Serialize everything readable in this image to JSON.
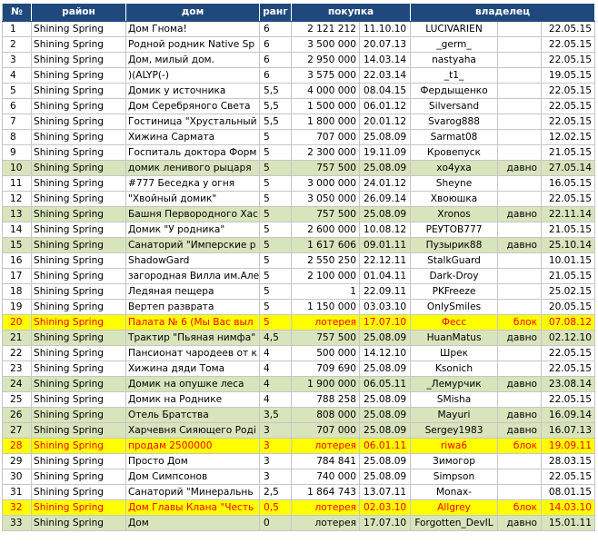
{
  "headers": {
    "num": "№",
    "district": "район",
    "house": "дом",
    "rank": "ранг",
    "purchase": "покупка",
    "owner": "владелец"
  },
  "colors": {
    "header_bg": "#1f497d",
    "header_text": "#ffffff",
    "green_row": "#d8e4bc",
    "yellow_row": "#ffff00",
    "yellow_row_text": "#ff0000"
  },
  "rows": [
    {
      "num": "1",
      "district": "Shining Spring",
      "house": "Дом Гнома!",
      "rank": "6",
      "price": "2 121 212",
      "date": "11.10.10",
      "owner": "LUCIVARIEN",
      "status": "",
      "owner_date": "22.05.15",
      "style": "plain"
    },
    {
      "num": "2",
      "district": "Shining Spring",
      "house": "Родной родник Native Sp",
      "rank": "6",
      "price": "3 500 000",
      "date": "20.07.13",
      "owner": "_germ_",
      "status": "",
      "owner_date": "22.05.15",
      "style": "plain"
    },
    {
      "num": "3",
      "district": "Shining Spring",
      "house": "Дом, милый дом.",
      "rank": "6",
      "price": "2 950 000",
      "date": "14.03.14",
      "owner": "nastyaha",
      "status": "",
      "owner_date": "22.05.15",
      "style": "plain"
    },
    {
      "num": "4",
      "district": "Shining Spring",
      "house": ")(ALYP(-)",
      "rank": "6",
      "price": "3 575 000",
      "date": "22.03.14",
      "owner": "_t1_",
      "status": "",
      "owner_date": "19.05.15",
      "style": "plain"
    },
    {
      "num": "5",
      "district": "Shining Spring",
      "house": "Домик у источника",
      "rank": "5,5",
      "price": "4 000 000",
      "date": "08.04.15",
      "owner": "Фердыщенко",
      "status": "",
      "owner_date": "22.05.15",
      "style": "plain"
    },
    {
      "num": "6",
      "district": "Shining Spring",
      "house": "Дом Серебряного Света",
      "rank": "5,5",
      "price": "1 500 000",
      "date": "06.01.12",
      "owner": "Silversand",
      "status": "",
      "owner_date": "22.05.15",
      "style": "plain"
    },
    {
      "num": "7",
      "district": "Shining Spring",
      "house": "Гостиница \"Хрустальный",
      "rank": "5,5",
      "price": "1 800 000",
      "date": "20.01.12",
      "owner": "Svarog888",
      "status": "",
      "owner_date": "22.05.15",
      "style": "plain"
    },
    {
      "num": "8",
      "district": "Shining Spring",
      "house": "Хижина Сармата",
      "rank": "5",
      "price": "707 000",
      "date": "25.08.09",
      "owner": "Sarmat08",
      "status": "",
      "owner_date": "12.02.15",
      "style": "plain"
    },
    {
      "num": "9",
      "district": "Shining Spring",
      "house": "Госпиталь доктора Форм",
      "rank": "5",
      "price": "2 300 000",
      "date": "19.11.09",
      "owner": "Кровепуск",
      "status": "",
      "owner_date": "21.05.15",
      "style": "plain"
    },
    {
      "num": "10",
      "district": "Shining Spring",
      "house": "домик ленивого рыцаря",
      "rank": "5",
      "price": "757 500",
      "date": "25.08.09",
      "owner": "хо4уха",
      "status": "давно",
      "owner_date": "27.05.14",
      "style": "green"
    },
    {
      "num": "11",
      "district": "Shining Spring",
      "house": "#777 Беседка у огня",
      "rank": "5",
      "price": "3 000 000",
      "date": "24.01.12",
      "owner": "Sheyne",
      "status": "",
      "owner_date": "16.05.15",
      "style": "plain"
    },
    {
      "num": "12",
      "district": "Shining Spring",
      "house": "\"Хвойный домик\"",
      "rank": "5",
      "price": "3 050 000",
      "date": "26.09.14",
      "owner": "Хвоюшка",
      "status": "",
      "owner_date": "22.05.15",
      "style": "plain"
    },
    {
      "num": "13",
      "district": "Shining Spring",
      "house": "Башня Первородного Хас",
      "rank": "5",
      "price": "757 500",
      "date": "25.08.09",
      "owner": "Xronos",
      "status": "давно",
      "owner_date": "22.11.14",
      "style": "green"
    },
    {
      "num": "14",
      "district": "Shining Spring",
      "house": "Домик \"У родника\"",
      "rank": "5",
      "price": "2 600 000",
      "date": "10.08.12",
      "owner": "РЕУТОВ777",
      "status": "",
      "owner_date": "21.05.15",
      "style": "plain"
    },
    {
      "num": "15",
      "district": "Shining Spring",
      "house": "Санаторий \"Имперские р",
      "rank": "5",
      "price": "1 617 606",
      "date": "09.01.11",
      "owner": "Пузырик88",
      "status": "давно",
      "owner_date": "25.10.14",
      "style": "green"
    },
    {
      "num": "16",
      "district": "Shining Spring",
      "house": "ShadowGard",
      "rank": "5",
      "price": "2 550 250",
      "date": "22.12.11",
      "owner": "StalkGuard",
      "status": "",
      "owner_date": "10.01.15",
      "style": "plain"
    },
    {
      "num": "17",
      "district": "Shining Spring",
      "house": "загородная Вилла им.Але",
      "rank": "5",
      "price": "2 100 000",
      "date": "01.04.11",
      "owner": "Dark-Droy",
      "status": "",
      "owner_date": "21.05.15",
      "style": "plain"
    },
    {
      "num": "18",
      "district": "Shining Spring",
      "house": "Ледяная пещера",
      "rank": "5",
      "price": "1",
      "date": "22.09.11",
      "owner": "PKFreeze",
      "status": "",
      "owner_date": "25.02.15",
      "style": "plain"
    },
    {
      "num": "19",
      "district": "Shining Spring",
      "house": "Вертеп разврата",
      "rank": "5",
      "price": "1 150 000",
      "date": "03.03.10",
      "owner": "OnlySmiles",
      "status": "",
      "owner_date": "20.05.15",
      "style": "plain"
    },
    {
      "num": "20",
      "district": "Shining Spring",
      "house": "Палата № 6 (Мы Вас выл",
      "rank": "5",
      "price": "лотерея",
      "date": "17.07.10",
      "owner": "Фесс",
      "status": "блок",
      "owner_date": "07.08.12",
      "style": "yellow"
    },
    {
      "num": "21",
      "district": "Shining Spring",
      "house": "Трактир \"Пьяная нимфа\"",
      "rank": "4,5",
      "price": "757 500",
      "date": "25.08.09",
      "owner": "HuanMatus",
      "status": "давно",
      "owner_date": "02.12.10",
      "style": "green"
    },
    {
      "num": "22",
      "district": "Shining Spring",
      "house": "Пансионат чародеев от к",
      "rank": "4",
      "price": "500 000",
      "date": "14.12.10",
      "owner": "Шрек",
      "status": "",
      "owner_date": "22.05.15",
      "style": "plain"
    },
    {
      "num": "23",
      "district": "Shining Spring",
      "house": "Хижина дяди Тома",
      "rank": "4",
      "price": "709 690",
      "date": "25.08.09",
      "owner": "Ksonich",
      "status": "",
      "owner_date": "22.05.15",
      "style": "plain"
    },
    {
      "num": "24",
      "district": "Shining Spring",
      "house": "Домик на опушке леса",
      "rank": "4",
      "price": "1 900 000",
      "date": "06.05.11",
      "owner": "_Лемурчик",
      "status": "давно",
      "owner_date": "23.08.14",
      "style": "green"
    },
    {
      "num": "25",
      "district": "Shining Spring",
      "house": "Домик на Роднике",
      "rank": "4",
      "price": "788 258",
      "date": "25.08.09",
      "owner": "SMisha",
      "status": "",
      "owner_date": "22.05.15",
      "style": "plain"
    },
    {
      "num": "26",
      "district": "Shining Spring",
      "house": "Отель Братства",
      "rank": "3,5",
      "price": "808 000",
      "date": "25.08.09",
      "owner": "Mayuri",
      "status": "давно",
      "owner_date": "16.09.14",
      "style": "green"
    },
    {
      "num": "27",
      "district": "Shining Spring",
      "house": "Харчевня Сияющего Роді",
      "rank": "3",
      "price": "707 000",
      "date": "25.08.09",
      "owner": "Sergey1983",
      "status": "давно",
      "owner_date": "16.07.13",
      "style": "green"
    },
    {
      "num": "28",
      "district": "Shining Spring",
      "house": "продам 2500000",
      "rank": "3",
      "price": "лотерея",
      "date": "06.01.11",
      "owner": "riwa6",
      "status": "блок",
      "owner_date": "19.09.11",
      "style": "yellow"
    },
    {
      "num": "29",
      "district": "Shining Spring",
      "house": "Просто Дом",
      "rank": "3",
      "price": "784 841",
      "date": "25.08.09",
      "owner": "Зимогор",
      "status": "",
      "owner_date": "28.03.15",
      "style": "plain"
    },
    {
      "num": "30",
      "district": "Shining Spring",
      "house": "Дом Симпсонов",
      "rank": "3",
      "price": "740 000",
      "date": "25.08.09",
      "owner": "Simpson",
      "status": "",
      "owner_date": "22.05.15",
      "style": "plain"
    },
    {
      "num": "31",
      "district": "Shining Spring",
      "house": "Санаторий \"Минеральнь",
      "rank": "2,5",
      "price": "1 864 743",
      "date": "13.07.11",
      "owner": "Monax-",
      "status": "",
      "owner_date": "08.01.15",
      "style": "plain"
    },
    {
      "num": "32",
      "district": "Shining Spring",
      "house": "Дом Главы Клана \"Честь",
      "rank": "0,5",
      "price": "лотерея",
      "date": "02.03.10",
      "owner": "Allgrey",
      "status": "блок",
      "owner_date": "14.03.10",
      "style": "yellow"
    },
    {
      "num": "33",
      "district": "Shining Spring",
      "house": "Дом",
      "rank": "0",
      "price": "лотерея",
      "date": "17.07.10",
      "owner": "Forgotten_DevIL",
      "status": "давно",
      "owner_date": "15.01.11",
      "style": "green"
    }
  ]
}
